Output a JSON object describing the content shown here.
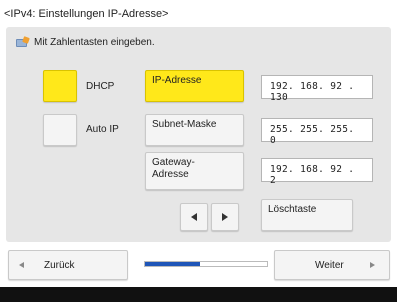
{
  "title": "<IPv4: Einstellungen IP-Adresse>",
  "hint": {
    "text": "Mit Zahlentasten eingeben.",
    "icon": "keypad-pen-icon"
  },
  "options": {
    "dhcp": {
      "label": "DHCP",
      "selected": true
    },
    "auto_ip": {
      "label": "Auto IP",
      "selected": false
    }
  },
  "fields": {
    "ip": {
      "label": "IP-Adresse",
      "value": "192. 168. 92  . 130",
      "active": true
    },
    "subnet": {
      "label": "Subnet-Maske",
      "value": "255. 255. 255. 0"
    },
    "gateway": {
      "label_line1": "Gateway-",
      "label_line2": "Adresse",
      "value": "192. 168. 92  . 2"
    }
  },
  "controls": {
    "clear_label": "Löschtaste",
    "cursor_left_icon": "arrow-left-icon",
    "cursor_right_icon": "arrow-right-icon"
  },
  "navigation": {
    "back_label": "Zurück",
    "next_label": "Weiter",
    "progress": 0.45
  },
  "colors": {
    "accent_yellow": "#ffe81a",
    "progress_blue": "#1f56b8",
    "panel_bg": "#e6e6e6"
  }
}
